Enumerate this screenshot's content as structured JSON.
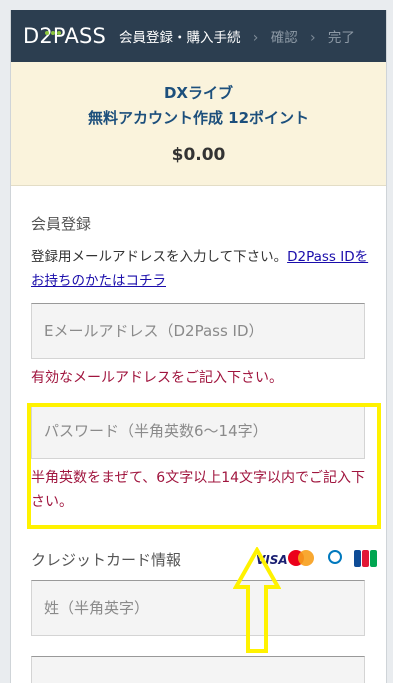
{
  "header": {
    "logo": "D2PASS",
    "steps": [
      "会員登録・購入手続",
      "確認",
      "完了"
    ]
  },
  "product": {
    "line1": "DXライブ",
    "line2": "無料アカウント作成 12ポイント",
    "price": "$0.00"
  },
  "registration": {
    "title": "会員登録",
    "instruction": "登録用メールアドレスを入力して下さい。",
    "link": "D2Pass IDをお持ちのかたはコチラ",
    "email_placeholder": "Eメールアドレス（D2Pass ID）",
    "email_error": "有効なメールアドレスをご記入下さい。",
    "password_placeholder": "パスワード（半角英数6〜14字）",
    "password_error": "半角英数をまぜて、6文字以上14文字以内でご記入下さい。"
  },
  "credit": {
    "title": "クレジットカード情報",
    "card_brands": [
      "VISA",
      "MasterCard",
      "Diners Club",
      "JCB"
    ],
    "lastname_placeholder": "姓（半角英字）"
  },
  "colors": {
    "header_bg": "#2c3e50",
    "error": "#a0153e",
    "highlight": "#fff200",
    "product_bg": "#faf3dc"
  }
}
